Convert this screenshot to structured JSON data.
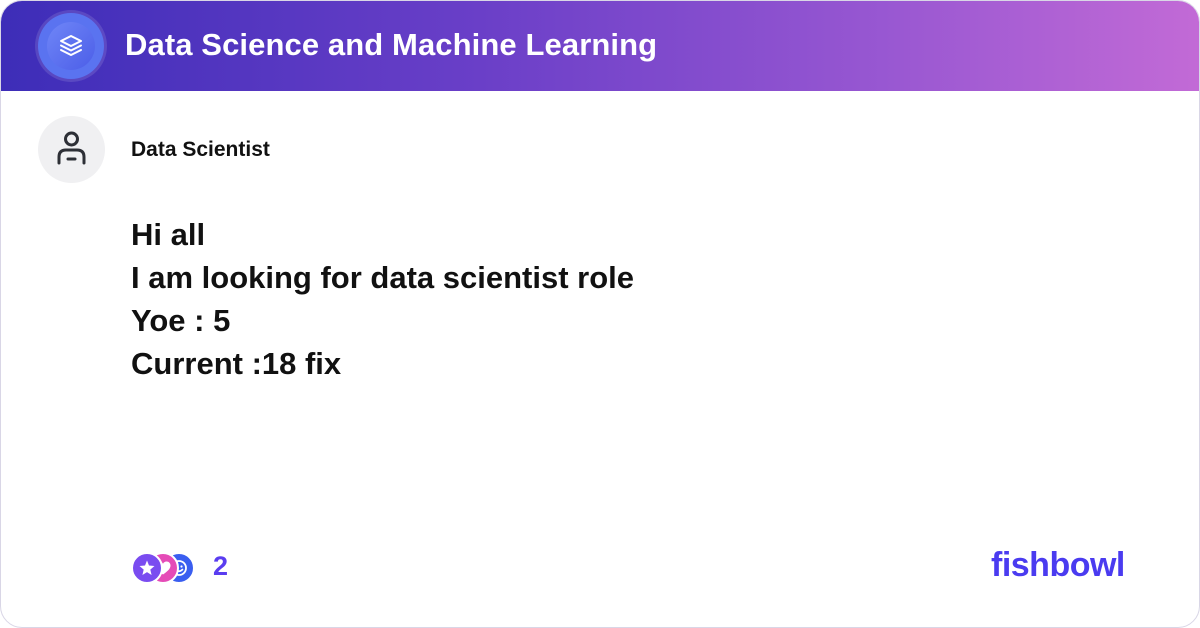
{
  "header": {
    "title": "Data Science and Machine Learning",
    "logo_icon": "layers-icon",
    "gradient_colors": [
      "#3d2db8",
      "#c26ad6"
    ]
  },
  "post": {
    "author": "Data Scientist",
    "avatar_icon": "user-icon",
    "lines": [
      "Hi all",
      "I am looking for data scientist role",
      "Yoe : 5",
      "Current :18 fix"
    ]
  },
  "reactions": {
    "icons": [
      "star-reaction-icon",
      "heart-reaction-icon",
      "smile-reaction-icon"
    ],
    "count": "2"
  },
  "brand": {
    "name": "fishbowl",
    "color": "#4a3bf0"
  }
}
